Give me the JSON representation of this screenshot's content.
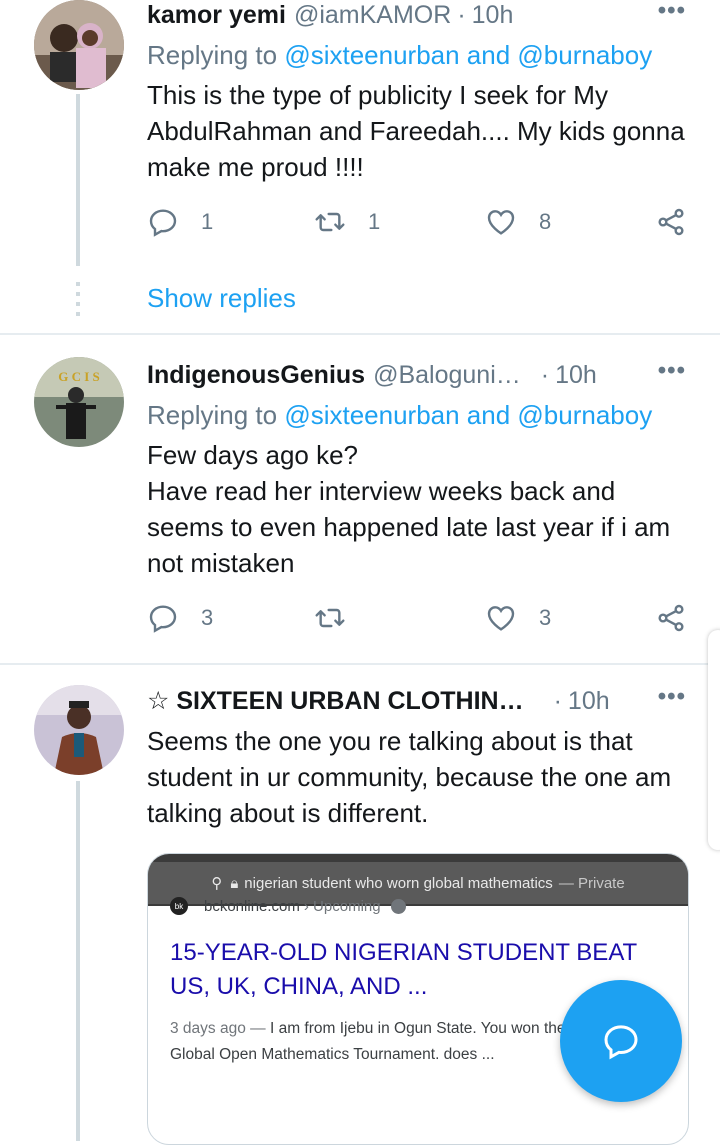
{
  "tweets": [
    {
      "name": "kamor yemi",
      "handle": "@iamKAMOR",
      "separator": "·",
      "time": "10h",
      "replying_prefix": "Replying to ",
      "replying_users": "@sixteenurban and @burnaboy",
      "text": "This is the type of publicity I seek for My AbdulRahman and Fareedah.... My kids gonna make me proud !!!!",
      "replies": "1",
      "retweets": "1",
      "likes": "8",
      "show_replies": "Show replies"
    },
    {
      "name": "IndigenousGenius",
      "handle": "@Baloguni…",
      "separator": "·",
      "time": "10h",
      "replying_prefix": "Replying to ",
      "replying_users": "@sixteenurban and @burnaboy",
      "text": "Few days ago ke?\nHave read her interview weeks back and seems to even happened late last year if i am not mistaken",
      "replies": "3",
      "retweets": "",
      "likes": "3",
      "avatar_text": "G C I S"
    },
    {
      "name": "☆ SIXTEEN URBAN CLOTHIN…",
      "separator": "·",
      "time": "10h",
      "text": "Seems the one you re talking about is that student in ur community, because the one am talking about is different."
    }
  ],
  "media": {
    "url_bar": "nigerian student who worn global mathematics",
    "url_private": "— Private",
    "site_logo": "bk",
    "site": "bckonline.com",
    "site_section": "› Upcoming",
    "headline": "15-YEAR-OLD NIGERIAN STUDENT BEAT US, UK, CHINA, AND ...",
    "snippet_date": "3 days ago —",
    "snippet": " I am from Ijebu in Ogun State. You won the Global Open Mathematics Tournament. does ..."
  },
  "colors": {
    "link": "#1da1f2",
    "muted": "#657786",
    "headline": "#1a0dab"
  },
  "icons": [
    "reply-icon",
    "retweet-icon",
    "like-icon",
    "share-icon",
    "more-icon",
    "compose-reply-icon"
  ]
}
